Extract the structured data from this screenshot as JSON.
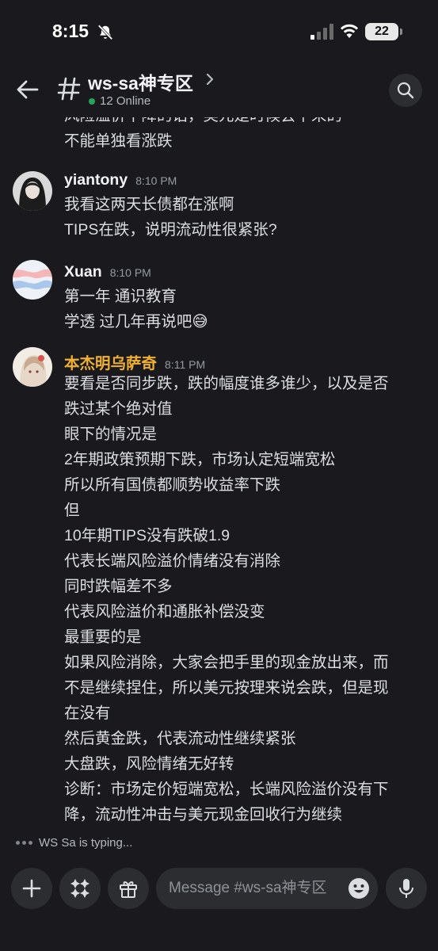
{
  "status": {
    "time": "8:15",
    "battery": "22"
  },
  "header": {
    "channel": "ws-sa神专区",
    "online": "12 Online"
  },
  "top_continuation": {
    "cut_text": "风险溢价下降的话，美元是时候会下来的",
    "lines": [
      "不能单独看涨跌"
    ]
  },
  "messages": [
    {
      "author": "yiantony",
      "time": "8:10 PM",
      "lines": [
        "我看这两天长债都在涨啊",
        "TIPS在跌，说明流动性很紧张?"
      ]
    },
    {
      "author": "Xuan",
      "time": "8:10 PM",
      "lines": [
        "第一年  通识教育",
        "学透 过几年再说吧😅"
      ]
    },
    {
      "author": "本杰明乌萨奇",
      "time": "8:11 PM",
      "lines": [
        "要看是否同步跌，跌的幅度谁多谁少，以及是否",
        "跌过某个绝对值",
        "眼下的情况是",
        "2年期政策预期下跌，市场认定短端宽松",
        "所以所有国债都顺势收益率下跌",
        "但",
        "10年期TIPS没有跌破1.9",
        "代表长端风险溢价情绪没有消除",
        "同时跌幅差不多",
        "代表风险溢价和通胀补偿没变",
        "最重要的是",
        "如果风险消除，大家会把手里的现金放出来，而",
        "不是继续捏住，所以美元按理来说会跌，但是现",
        "在没有",
        "然后黄金跌，代表流动性继续紧张",
        "大盘跌，风险情绪无好转",
        "诊断：市场定价短端宽松，长端风险溢价没有下",
        "降，流动性冲击与美元现金回收行为继续"
      ]
    }
  ],
  "typing": "WS Sa is typing...",
  "composer": {
    "placeholder": "Message #ws-sa神专区"
  },
  "colors": {
    "background": "#1a1a1e",
    "author_highlight": "#f0b132",
    "online": "#23a55a"
  }
}
